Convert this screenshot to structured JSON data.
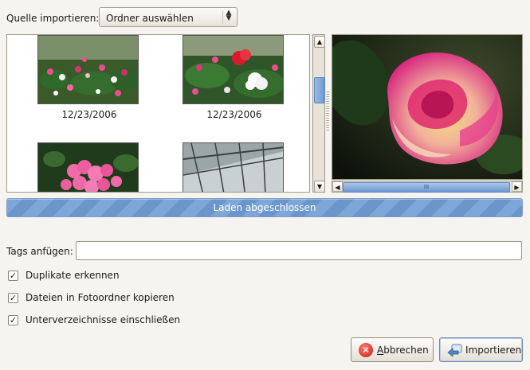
{
  "source": {
    "label": "Quelle importieren:",
    "selected": "Ordner auswählen"
  },
  "thumbnails": [
    {
      "date": "12/23/2006",
      "subject": "pink and white cyclamen flower bed"
    },
    {
      "date": "12/23/2006",
      "subject": "red and white cyclamen flowers"
    },
    {
      "date": "",
      "subject": "pink cyclamen"
    },
    {
      "date": "",
      "subject": "glass greenhouse roof"
    }
  ],
  "preview": {
    "subject": "pink and yellow rose"
  },
  "hscroll_grip": "III",
  "progress": {
    "label": "Laden abgeschlossen",
    "fraction": 1.0
  },
  "tags": {
    "label": "Tags anfügen:",
    "value": ""
  },
  "checkboxes": [
    {
      "label": "Duplikate erkennen",
      "checked": true
    },
    {
      "label": "Dateien in Fotoordner kopieren",
      "checked": true
    },
    {
      "label": "Unterverzeichnisse einschließen",
      "checked": true
    }
  ],
  "buttons": {
    "cancel_accel": "A",
    "cancel_rest": "bbrechen",
    "import_label": "Importieren"
  },
  "colors": {
    "accent": "#6a96cc",
    "window_bg": "#f6f4f0"
  }
}
